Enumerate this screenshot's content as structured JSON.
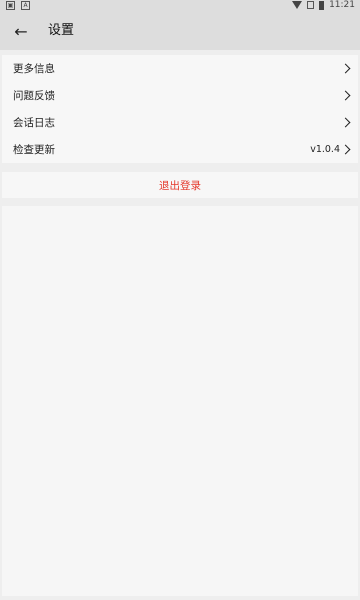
{
  "status_bar": {
    "time": "11:21",
    "icons": [
      "image-icon",
      "a-icon",
      "wifi-icon",
      "sim-icon",
      "battery-icon"
    ]
  },
  "header": {
    "back_icon": "arrow-left-icon",
    "title": "设置"
  },
  "settings": {
    "items": [
      {
        "label": "更多信息",
        "value": ""
      },
      {
        "label": "问题反馈",
        "value": ""
      },
      {
        "label": "会话日志",
        "value": ""
      },
      {
        "label": "检查更新",
        "value": "v1.0.4"
      }
    ]
  },
  "logout": {
    "label": "退出登录",
    "color": "#e5382b"
  },
  "colors": {
    "app_bar": "#dddddd",
    "background": "#eeeeee",
    "card": "#f7f7f7"
  }
}
